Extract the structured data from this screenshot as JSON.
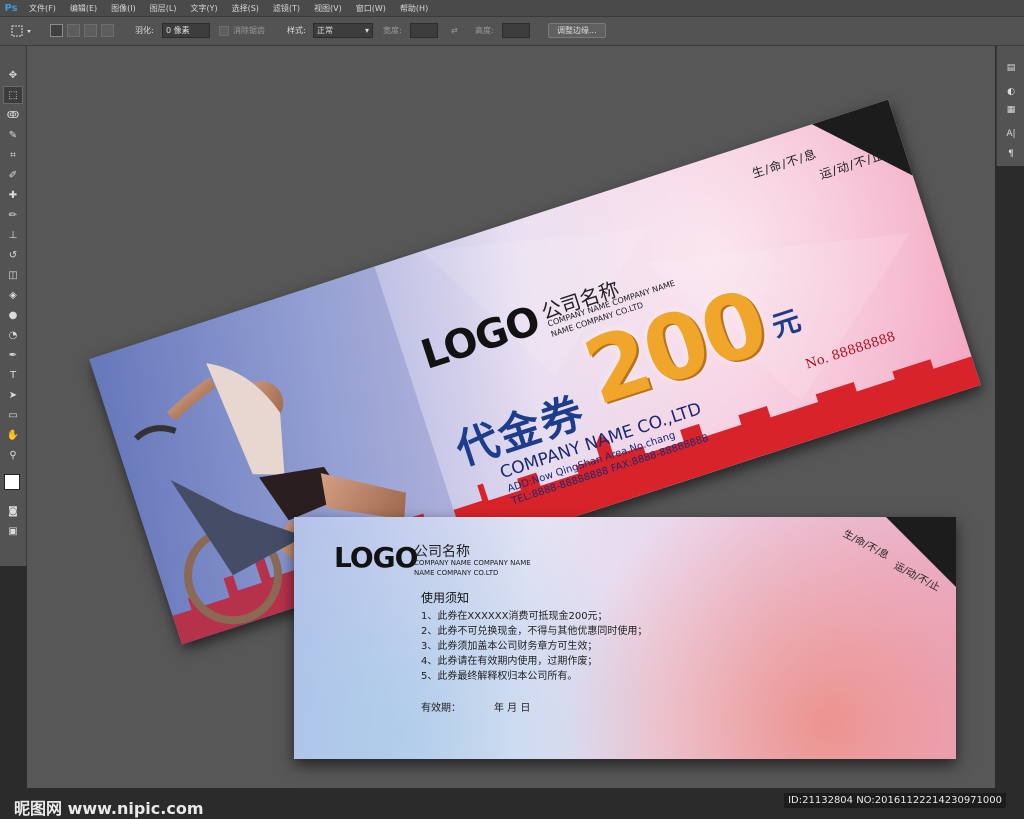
{
  "app": {
    "logo": "Ps",
    "menus": [
      "文件(F)",
      "编辑(E)",
      "图像(I)",
      "图层(L)",
      "文字(Y)",
      "选择(S)",
      "滤镜(T)",
      "视图(V)",
      "窗口(W)",
      "帮助(H)"
    ]
  },
  "options": {
    "feather_label": "羽化:",
    "feather_value": "0 像素",
    "antialias_label": "消除锯齿",
    "style_label": "样式:",
    "style_value": "正常",
    "width_label": "宽度:",
    "height_label": "高度:",
    "refine_edge": "调整边缘..."
  },
  "tools": [
    "move-tool-icon",
    "marquee-tool-icon",
    "lasso-tool-icon",
    "quick-select-icon",
    "crop-tool-icon",
    "eyedropper-icon",
    "healing-brush-icon",
    "brush-tool-icon",
    "clone-stamp-icon",
    "history-brush-icon",
    "eraser-tool-icon",
    "paint-bucket-icon",
    "blur-tool-icon",
    "dodge-tool-icon",
    "pen-tool-icon",
    "type-tool-icon",
    "path-select-icon",
    "shape-tool-icon",
    "hand-tool-icon",
    "zoom-tool-icon"
  ],
  "front": {
    "slogan_1": "生/命/不/息",
    "slogan_2": "运/动/不/止",
    "logo": "LOGO",
    "company_cn": "公司名称",
    "company_en_1": "COMPANY NAME COMPANY NAME",
    "company_en_2": "NAME COMPANY CO.LTD",
    "title": "代金券",
    "amount": "200",
    "unit": "元",
    "serial": "No. 88888888",
    "company_name": "COMPANY NAME CO.,LTD",
    "address": "ADD:Now QingShan Area.No.chang",
    "tel": "TEL:8888-88888888   FAX:8888-88888888"
  },
  "back": {
    "slogan_1": "生/命/不/息",
    "slogan_2": "运/动/不/止",
    "logo": "LOGO",
    "company_cn": "公司名称",
    "company_en_1": "COMPANY NAME COMPANY NAME",
    "company_en_2": "NAME COMPANY CO.LTD",
    "notice_title": "使用须知",
    "rules": [
      "1、此券在XXXXXX消费可抵现金200元；",
      "2、此券不可兑换现金，不得与其他优惠同时使用；",
      "3、此券须加盖本公司财务章方可生效；",
      "4、此券请在有效期内使用，过期作废；",
      "5、此券最终解释权归本公司所有。"
    ],
    "validity_label": "有效期：",
    "validity_date": "年    月    日"
  },
  "footer": {
    "watermark": "昵图网 www.nipic.com",
    "image_id": "ID:21132804 NO:20161122214230971000"
  },
  "colors": {
    "ps_dark": "#2b2b2b",
    "ps_panel": "#535353",
    "ps_canvas": "#575757",
    "title_blue": "#1d3d8c",
    "amount_gold": "#f0a52b",
    "skyline_red": "#d8232a"
  }
}
